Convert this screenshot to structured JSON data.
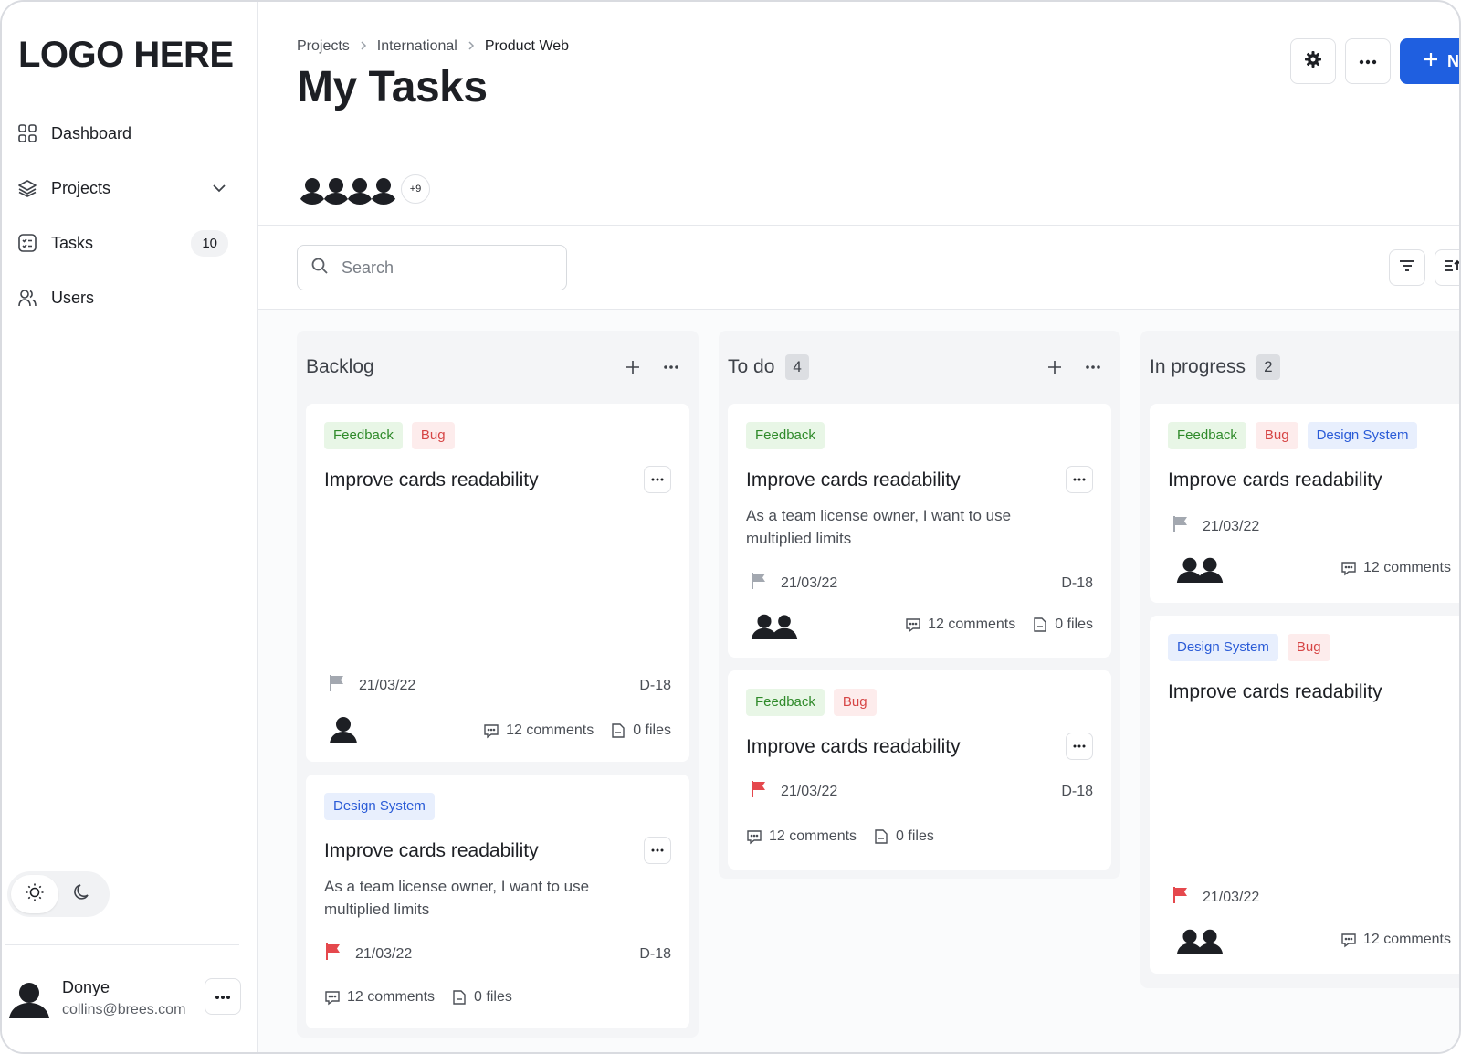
{
  "app": {
    "logo": "LOGO HERE"
  },
  "sidebar": {
    "items": [
      {
        "label": "Dashboard",
        "icon": "grid-icon"
      },
      {
        "label": "Projects",
        "icon": "layers-icon"
      },
      {
        "label": "Tasks",
        "icon": "checklist-icon",
        "badge": "10"
      },
      {
        "label": "Users",
        "icon": "users-icon"
      }
    ],
    "user": {
      "name": "Donye",
      "email": "collins@brees.com"
    }
  },
  "header": {
    "breadcrumb": [
      "Projects",
      "International",
      "Product Web"
    ],
    "title": "My Tasks",
    "primary_label": "N",
    "members_more": "+9"
  },
  "search": {
    "placeholder": "Search",
    "value": ""
  },
  "columns": [
    {
      "title": "Backlog",
      "count": "",
      "cards": [
        {
          "tags": [
            "Feedback",
            "Bug"
          ],
          "title": "Improve cards readability",
          "desc": "",
          "date": "21/03/22",
          "code": "D-18",
          "comments": "12 comments",
          "files": "0 files"
        },
        {
          "tags": [
            "Design System"
          ],
          "title": "Improve cards readability",
          "desc": "As a team license owner, I want to use multiplied limits",
          "date": "21/03/22",
          "code": "D-18",
          "comments": "12 comments",
          "files": "0 files"
        }
      ]
    },
    {
      "title": "To do",
      "count": "4",
      "cards": [
        {
          "tags": [
            "Feedback"
          ],
          "title": "Improve cards readability",
          "desc": "As a team license owner, I want to use multiplied limits",
          "date": "21/03/22",
          "code": "D-18",
          "comments": "12 comments",
          "files": "0 files"
        },
        {
          "tags": [
            "Feedback",
            "Bug"
          ],
          "title": "Improve cards readability",
          "desc": "",
          "date": "21/03/22",
          "code": "D-18",
          "comments": "12 comments",
          "files": "0 files"
        }
      ]
    },
    {
      "title": "In progress",
      "count": "2",
      "cards": [
        {
          "tags": [
            "Feedback",
            "Bug",
            "Design System"
          ],
          "title": "Improve cards readability",
          "date": "21/03/22",
          "comments": "12 comments"
        },
        {
          "tags": [
            "Design System",
            "Bug"
          ],
          "title": "Improve cards readability",
          "date": "21/03/22",
          "comments": "12 comments"
        }
      ]
    }
  ],
  "colors": {
    "primary": "#1f5fe0",
    "flag_red": "#e5484d",
    "flag_gray": "#a3a8b0"
  }
}
